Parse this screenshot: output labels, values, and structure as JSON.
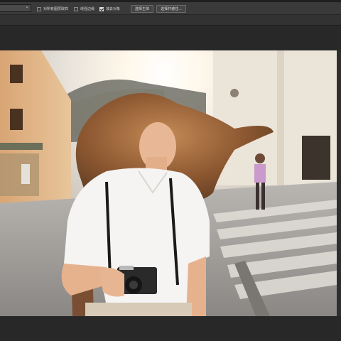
{
  "options_bar": {
    "dropdown_value": "",
    "sample_all_layers": {
      "label": "对所有图层取样",
      "checked": false
    },
    "enhance_edge": {
      "label": "增强边缘",
      "checked": false
    },
    "subtract_object": {
      "label": "减去对象",
      "checked": true
    },
    "select_subject_label": "选择主体",
    "select_and_mask_label": "选择并遮住..."
  },
  "document": {
    "content": "photo of a curly-haired woman with a camera on a sunlit street"
  }
}
